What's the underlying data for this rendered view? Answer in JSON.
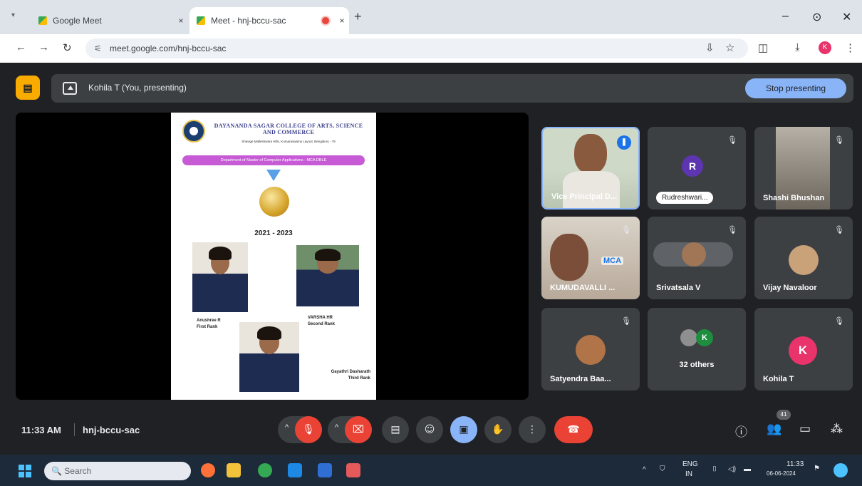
{
  "browser": {
    "tabs": [
      {
        "title": "Google Meet",
        "close": "×"
      },
      {
        "title": "Meet - hnj-bccu-sac",
        "close": "×"
      }
    ],
    "new_tab": "+",
    "url": "meet.google.com/hnj-bccu-sac",
    "profile_initial": "K",
    "window_controls": {
      "minimize": "–",
      "restore": "⊙",
      "close": "✕"
    }
  },
  "meet": {
    "app_icon": "▤",
    "presenting_label": "Kohila T (You, presenting)",
    "stop_presenting": "Stop presenting",
    "slide": {
      "college": "DAYANANDA SAGAR COLLEGE OF ARTS, SCIENCE AND COMMERCE",
      "address": "Shavige Malleshwara Hills, Kumaraswamy Layout, Bengaluru - 78",
      "department": "Department of Master of Computer Applications - MCA DBLE",
      "years": "2021 - 2023",
      "ranks": [
        {
          "name": "Anushree R",
          "rank": "First Rank"
        },
        {
          "name": "VARSHA HR",
          "rank": "Second Rank"
        },
        {
          "name": "Gayathri Dasharath",
          "rank": "Third Rank"
        }
      ]
    },
    "participants": [
      {
        "name": "Vice Principal D...",
        "type": "video"
      },
      {
        "name": "Rudreshwari...",
        "initial": "R"
      },
      {
        "name": "Shashi Bhushan",
        "type": "video"
      },
      {
        "name": "KUMUDAVALLI ...",
        "type": "video",
        "overlay": "MCA"
      },
      {
        "name": "Srivatsala V"
      },
      {
        "name": "Vijay Navaloor"
      },
      {
        "name": "Satyendra Baa..."
      },
      {
        "name": "32 others",
        "initial": "K"
      },
      {
        "name": "Kohila T",
        "initial": "K"
      }
    ],
    "colors": {
      "red": "#ea4335",
      "blue": "#8ab4f8",
      "bg": "#202124",
      "tile": "#3c4043"
    }
  },
  "bottom": {
    "time": "11:33 AM",
    "meeting_code": "hnj-bccu-sac",
    "participant_count": "41"
  },
  "taskbar": {
    "search_placeholder": "Search",
    "lang": "ENG",
    "region": "IN",
    "clock_time": "11:33",
    "clock_date": "06-06-2024"
  }
}
